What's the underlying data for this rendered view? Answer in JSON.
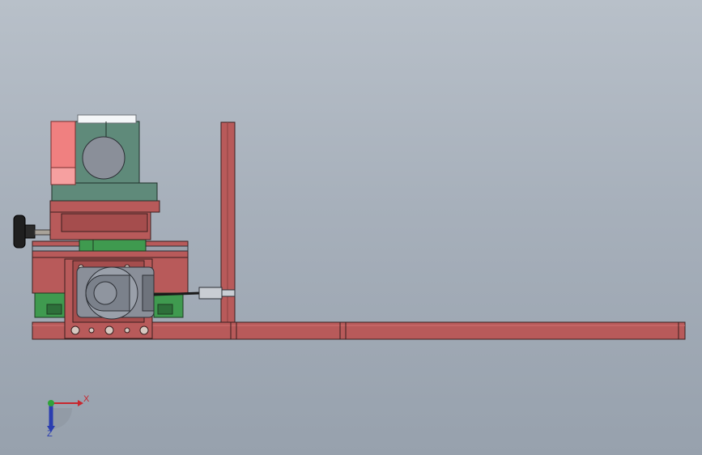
{
  "viewport": {
    "background_top": "#b8c0c9",
    "background_bottom": "#97a1ad"
  },
  "triad": {
    "x_label": "X",
    "z_label": "Z",
    "x_color": "#c8262e",
    "y_color": "#2fa33a",
    "z_color": "#2a3db0"
  },
  "model": {
    "frame_color": "#b85a5a",
    "block_color": "#5f8a7a",
    "rail_color": "#3f9a4f",
    "motor_color": "#8a8f99",
    "pink_color": "#f08080"
  }
}
